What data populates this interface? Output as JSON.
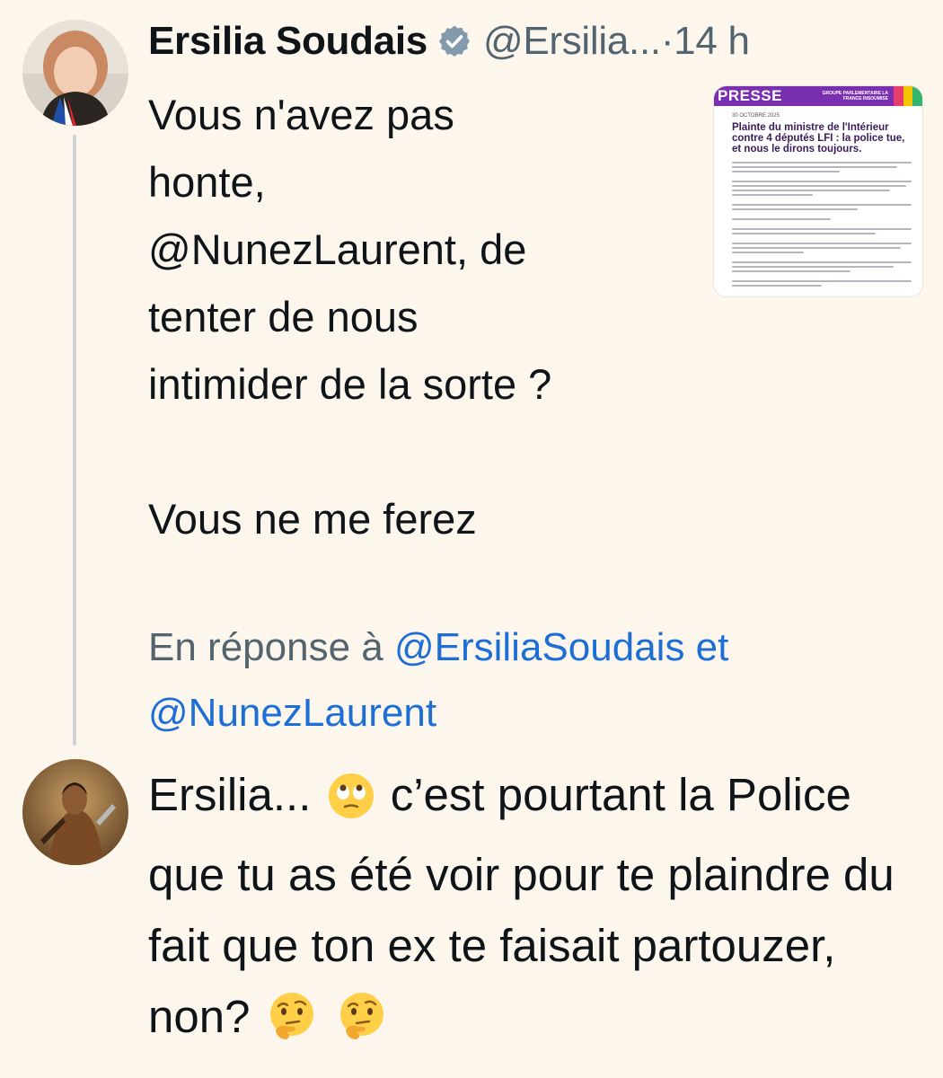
{
  "tweet1": {
    "display_name": "Ersilia Soudais",
    "handle": "@Ersilia...",
    "separator": "·",
    "time": "14 h",
    "verified_icon": "verified-badge-icon",
    "text_lines": [
      "Vous n'avez pas",
      "honte,",
      "@NunezLaurent, de",
      "tenter de nous",
      "intimider de la sorte ?"
    ],
    "text_line_2": "Vous ne me ferez",
    "media": {
      "banner_title": "PRESSE",
      "banner_group": "GROUPE PARLEMENTAIRE LA FRANCE INSOUMISE",
      "date": "30 OCTOBRE 2025",
      "headline": "Plainte du ministre de l'Intérieur contre 4 députés LFI : la police tue, et nous le dirons toujours."
    }
  },
  "reply_info": {
    "prefix": "En réponse à ",
    "mention1": "@ErsiliaSoudais",
    "conjunction": " et",
    "mention2": "@NunezLaurent"
  },
  "tweet2": {
    "text_part1": "Ersilia...",
    "emoji1": "eye-roll-emoji",
    "text_part2": " c’est pourtant la Police que tu as été voir pour te plaindre du fait que ton ex te faisait partouzer, non?",
    "emoji2": "thinking-face-emoji",
    "emoji3": "thinking-face-emoji"
  },
  "colors": {
    "background": "#fcf6ec",
    "link": "#1d6fd6",
    "muted": "#536471",
    "text": "#0f1419",
    "banner": "#7a2fb0"
  }
}
